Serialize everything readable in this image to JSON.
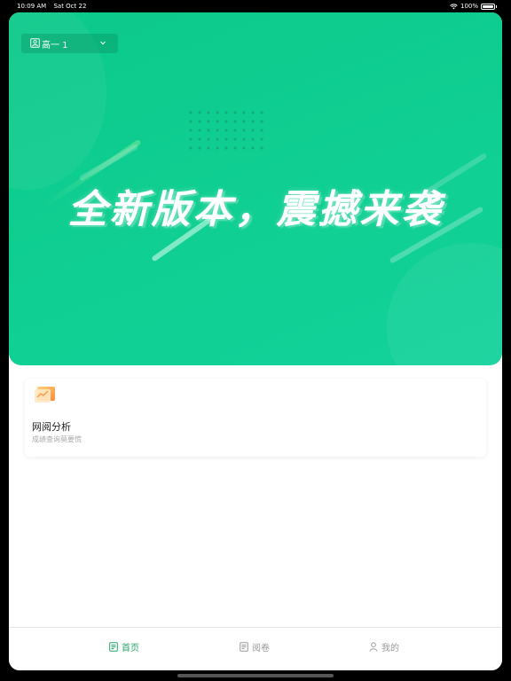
{
  "status_bar": {
    "time": "10:09 AM",
    "date": "Sat Oct 22",
    "battery": "100%"
  },
  "hero": {
    "class_selector": "高一 1",
    "title": "全新版本，震撼来袭"
  },
  "feature_card": {
    "icon": "chart-icon",
    "title": "网阅分析",
    "subtitle": "成绩查询莫要慌"
  },
  "tab_bar": {
    "tabs": [
      {
        "label": "首页",
        "icon": "home-icon",
        "active": true
      },
      {
        "label": "阅卷",
        "icon": "document-icon",
        "active": false
      },
      {
        "label": "我的",
        "icon": "person-icon",
        "active": false
      }
    ]
  },
  "colors": {
    "brand": "#10cf92",
    "active_tab": "#27a46a",
    "inactive_tab": "#999999"
  }
}
